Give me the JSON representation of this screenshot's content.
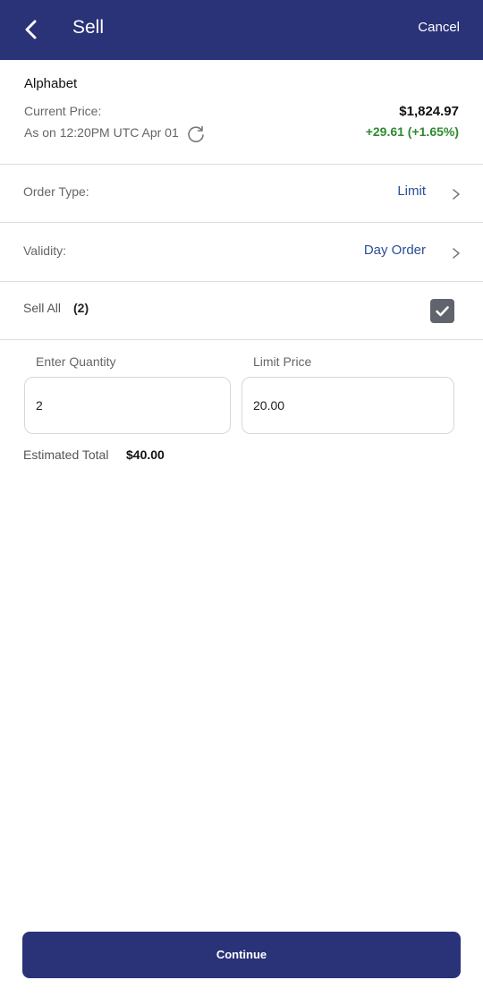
{
  "header": {
    "title": "Sell",
    "cancel_label": "Cancel",
    "background": "#2a3278"
  },
  "stock": {
    "name": "Alphabet",
    "current_price_label": "Current Price:",
    "as_of": "As on 12:20PM UTC Apr 01",
    "price": "$1,824.97",
    "change": "+29.61 (+1.65%)",
    "change_color": "#2f8a2f"
  },
  "order_type": {
    "label": "Order Type:",
    "value": "Limit"
  },
  "validity": {
    "label": "Validity:",
    "value": "Day Order"
  },
  "sell_all": {
    "label": "Sell All",
    "count": "(2)",
    "checked": true
  },
  "quantity": {
    "label": "Enter Quantity",
    "value": "2"
  },
  "limit_price": {
    "label": "Limit Price",
    "value": "20.00"
  },
  "estimate": {
    "label": "Estimated Total",
    "value": "$40.00"
  },
  "continue_label": "Continue",
  "icons": [
    "back-arrow-icon",
    "refresh-icon",
    "chevron-right-icon",
    "checkmark-icon"
  ]
}
